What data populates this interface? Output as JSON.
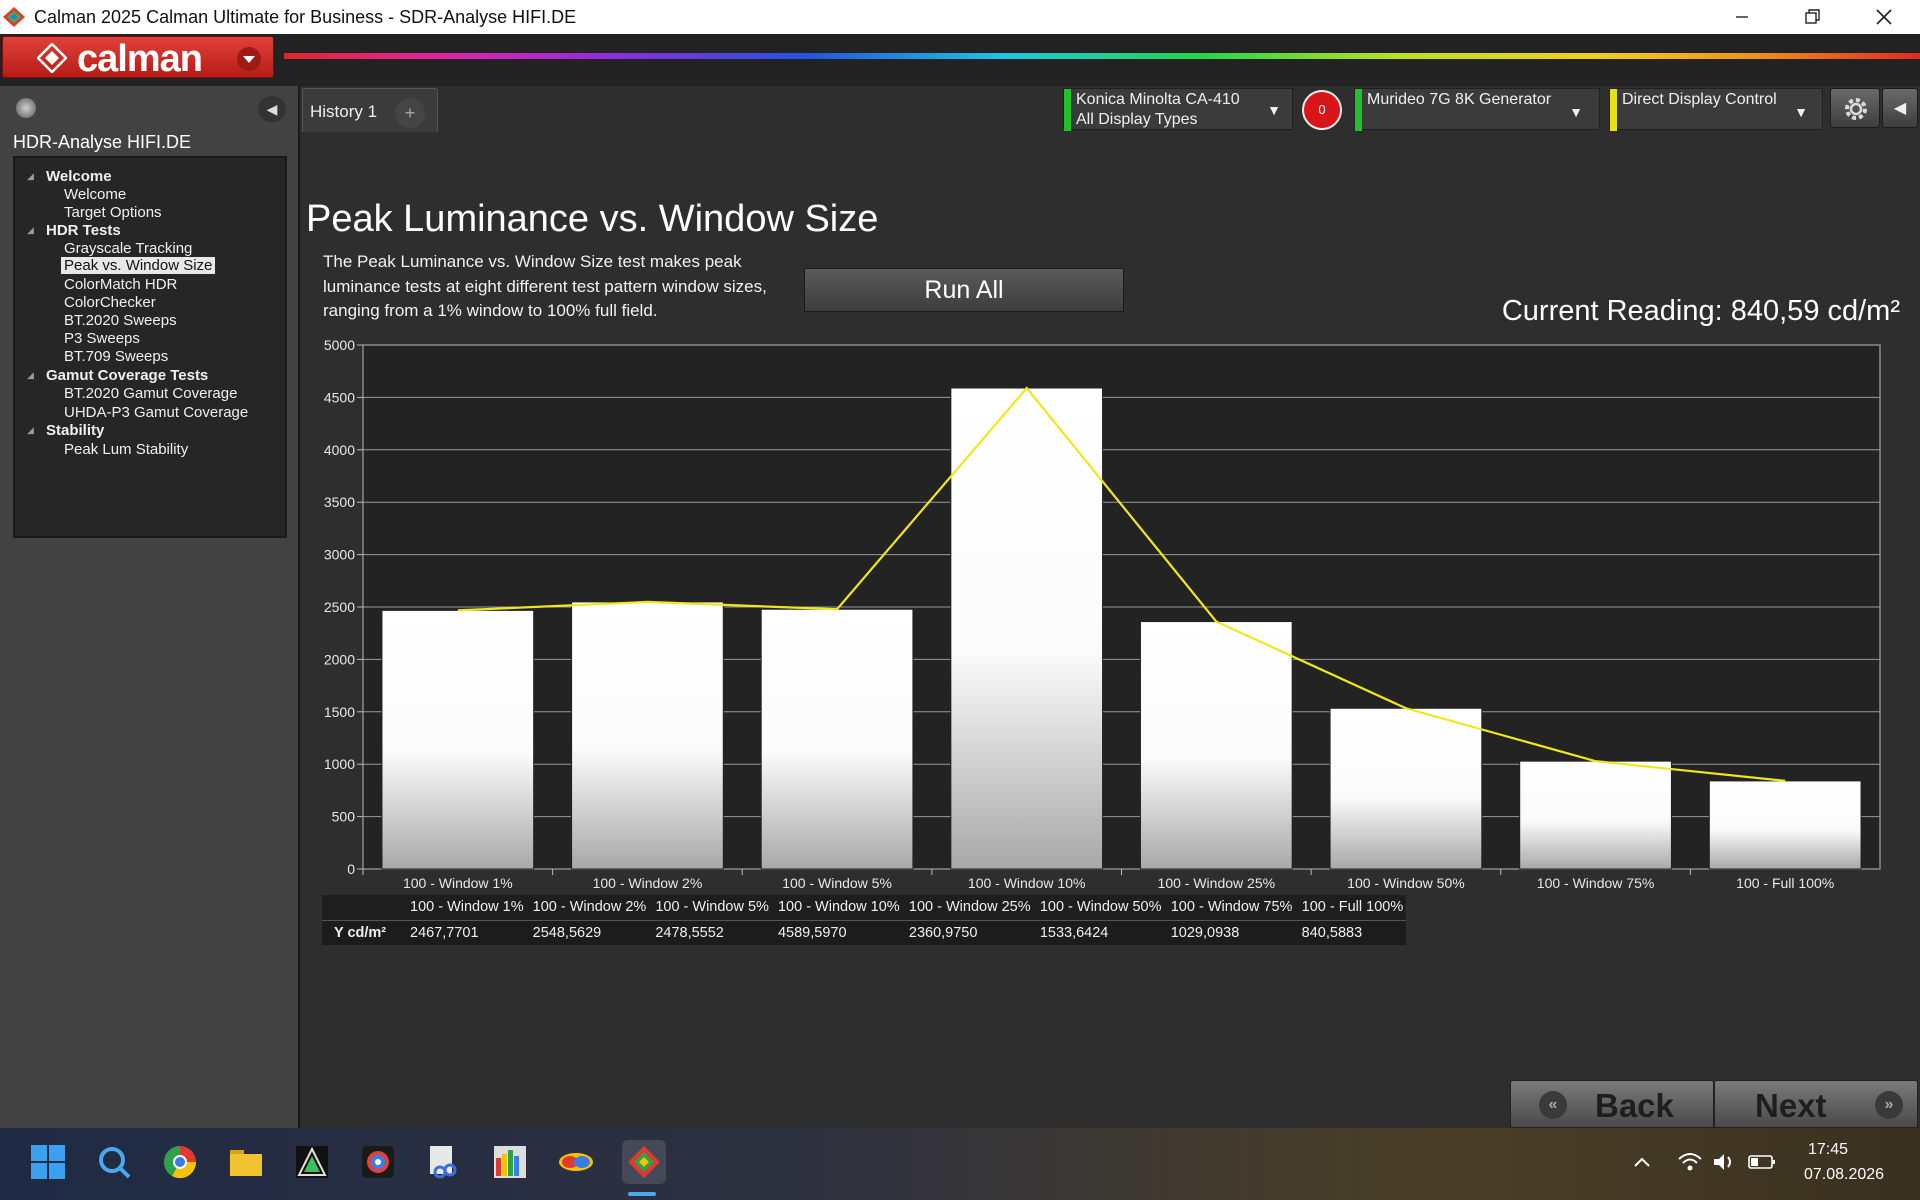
{
  "window": {
    "title": "Calman 2025 Calman Ultimate for Business  - SDR-Analyse HIFI.DE"
  },
  "logo": {
    "text": "calman"
  },
  "sidebar": {
    "project": "HDR-Analyse HIFI.DE",
    "groups": [
      {
        "label": "Welcome",
        "items": [
          "Welcome",
          "Target Options"
        ]
      },
      {
        "label": "HDR Tests",
        "items": [
          "Grayscale Tracking",
          "Peak vs. Window Size",
          "ColorMatch HDR",
          "ColorChecker",
          "BT.2020 Sweeps",
          "P3 Sweeps",
          "BT.709 Sweeps"
        ]
      },
      {
        "label": "Gamut Coverage Tests",
        "items": [
          "BT.2020 Gamut Coverage",
          "UHDA-P3 Gamut Coverage"
        ]
      },
      {
        "label": "Stability",
        "items": [
          "Peak Lum Stability"
        ]
      }
    ],
    "selected": "Peak vs. Window Size"
  },
  "tabs": {
    "history": "History 1",
    "add": "+"
  },
  "devices": {
    "meter": {
      "line1": "Konica Minolta CA-410",
      "line2": "All Display Types",
      "color": "#22c02a"
    },
    "record_count": "0",
    "generator": {
      "line1": "Murideo 7G 8K Generator",
      "color": "#22c02a"
    },
    "display": {
      "line1": "Direct Display Control",
      "color": "#e6e01a"
    }
  },
  "page": {
    "title": "Peak Luminance vs. Window Size",
    "description": "The Peak Luminance vs. Window Size test makes peak luminance tests at eight different test pattern window sizes, ranging from a 1% window to 100% full field.",
    "run_all": "Run All",
    "current_reading": "Current Reading: 840,59 cd/m²"
  },
  "chart_data": {
    "type": "bar",
    "categories": [
      "100 - Window  1%",
      "100 - Window  2%",
      "100 - Window  5%",
      "100 - Window 10%",
      "100 - Window 25%",
      "100 - Window 50%",
      "100 - Window 75%",
      "100 - Full  100%"
    ],
    "series": [
      {
        "values": [
          2467.7701,
          2548.5629,
          2478.5552,
          4589.597,
          2360.975,
          1533.6424,
          1029.0938,
          840.5883
        ]
      }
    ],
    "line_overlay_color": "#f0e81a",
    "ylim": [
      0,
      5000
    ],
    "yticks": [
      0,
      500,
      1000,
      1500,
      2000,
      2500,
      3000,
      3500,
      4000,
      4500,
      5000
    ],
    "grid": true
  },
  "table": {
    "headers": [
      "100 - Window  1%",
      "100 - Window  2%",
      "100 - Window  5%",
      "100 - Window 10%",
      "100 - Window 25%",
      "100 - Window 50%",
      "100 - Window 75%",
      "100 - Full  100%"
    ],
    "row_label": "Y cd/m²",
    "values": [
      "2467,7701",
      "2548,5629",
      "2478,5552",
      "4589,5970",
      "2360,9750",
      "1533,6424",
      "1029,0938",
      "840,5883"
    ]
  },
  "nav": {
    "back": "Back",
    "next": "Next"
  },
  "taskbar": {
    "time": "17:45",
    "date": "07.08.2026",
    "icons": [
      "start-icon",
      "search-icon",
      "chrome-icon",
      "file-explorer-icon",
      "color-app-icon",
      "colorchecker-app-icon",
      "snipping-tool-icon",
      "spectrum-app-icon",
      "palette-app-icon",
      "calman-app-icon"
    ]
  }
}
